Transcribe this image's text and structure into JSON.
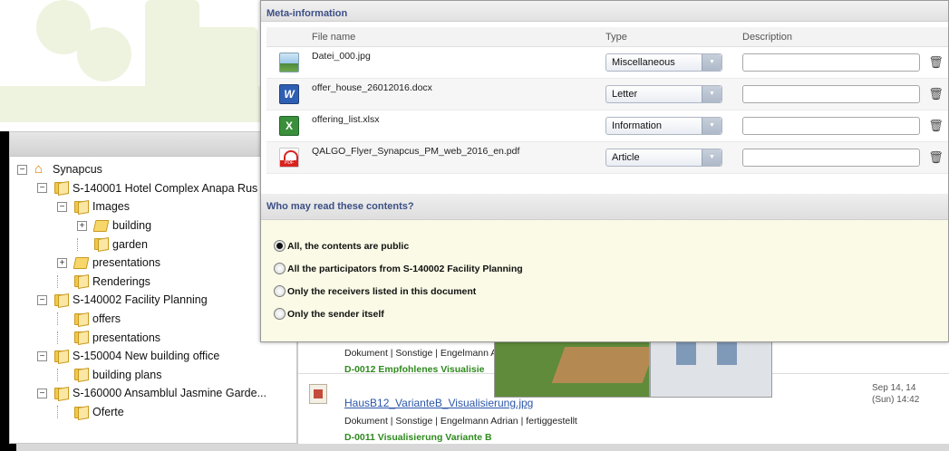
{
  "tree": {
    "nodes": [
      {
        "label": "Synapcus",
        "level": 0,
        "toggle": "−",
        "icon": "home-icon"
      },
      {
        "label": "S-140001 Hotel Complex Anapa Rus",
        "level": 1,
        "toggle": "−",
        "icon": "folder-icon"
      },
      {
        "label": "Images",
        "level": 2,
        "toggle": "−",
        "icon": "folder-icon"
      },
      {
        "label": "building",
        "level": 3,
        "toggle": "+",
        "icon": "folder-open-icon"
      },
      {
        "label": "garden",
        "level": 3,
        "toggle": "",
        "icon": "folder-icon"
      },
      {
        "label": "presentations",
        "level": 2,
        "toggle": "+",
        "icon": "folder-open-icon"
      },
      {
        "label": "Renderings",
        "level": 2,
        "toggle": "",
        "icon": "folder-icon"
      },
      {
        "label": "S-140002 Facility Planning",
        "level": 1,
        "toggle": "−",
        "icon": "folder-icon"
      },
      {
        "label": "offers",
        "level": 2,
        "toggle": "",
        "icon": "folder-icon"
      },
      {
        "label": "presentations",
        "level": 2,
        "toggle": "",
        "icon": "folder-icon"
      },
      {
        "label": "S-150004 New building office",
        "level": 1,
        "toggle": "−",
        "icon": "folder-icon"
      },
      {
        "label": "building plans",
        "level": 2,
        "toggle": "",
        "icon": "folder-icon"
      },
      {
        "label": "S-160000 Ansamblul Jasmine Garde...",
        "level": 1,
        "toggle": "−",
        "icon": "folder-icon"
      },
      {
        "label": "Oferte",
        "level": 2,
        "toggle": "",
        "icon": "folder-icon"
      }
    ]
  },
  "documents": {
    "doc1_meta": "Dokument | Sonstige | Engelmann A",
    "doc1_code": "D-0012 Empfohlenes Visualisie",
    "doc2_title": "HausB12_VarianteB_Visualisierung.jpg",
    "doc2_meta": "Dokument | Sonstige | Engelmann Adrian | fertiggestellt",
    "doc2_code": "D-0011 Visualisierung Variante B",
    "doc2_date_line1": "Sep 14, 14",
    "doc2_date_line2": "(Sun) 14:42"
  },
  "dialog": {
    "meta_title": "Meta-information",
    "columns": {
      "file_name": "File name",
      "type": "Type",
      "description": "Description"
    },
    "files": [
      {
        "name": "Datei_000.jpg",
        "type": "Miscellaneous",
        "icon": "image-file-icon",
        "kind": "jpg",
        "description": ""
      },
      {
        "name": "offer_house_26012016.docx",
        "type": "Letter",
        "icon": "word-file-icon",
        "kind": "docx",
        "description": ""
      },
      {
        "name": "offering_list.xlsx",
        "type": "Information",
        "icon": "excel-file-icon",
        "kind": "xlsx",
        "description": ""
      },
      {
        "name": "QALGO_Flyer_Synapcus_PM_web_2016_en.pdf",
        "type": "Article",
        "icon": "pdf-file-icon",
        "kind": "pdf",
        "description": ""
      }
    ],
    "who_title": "Who may read these contents?",
    "options": [
      {
        "label": "All, the contents are public",
        "checked": true
      },
      {
        "label": "All the participators from S-140002 Facility Planning",
        "checked": false
      },
      {
        "label": "Only the receivers listed in this document",
        "checked": false
      },
      {
        "label": "Only the sender itself",
        "checked": false
      }
    ]
  },
  "colors": {
    "section_title": "#3c4f86",
    "link": "#2b56a8",
    "green_code": "#2f8a1e",
    "who_bg": "#fafae6"
  }
}
